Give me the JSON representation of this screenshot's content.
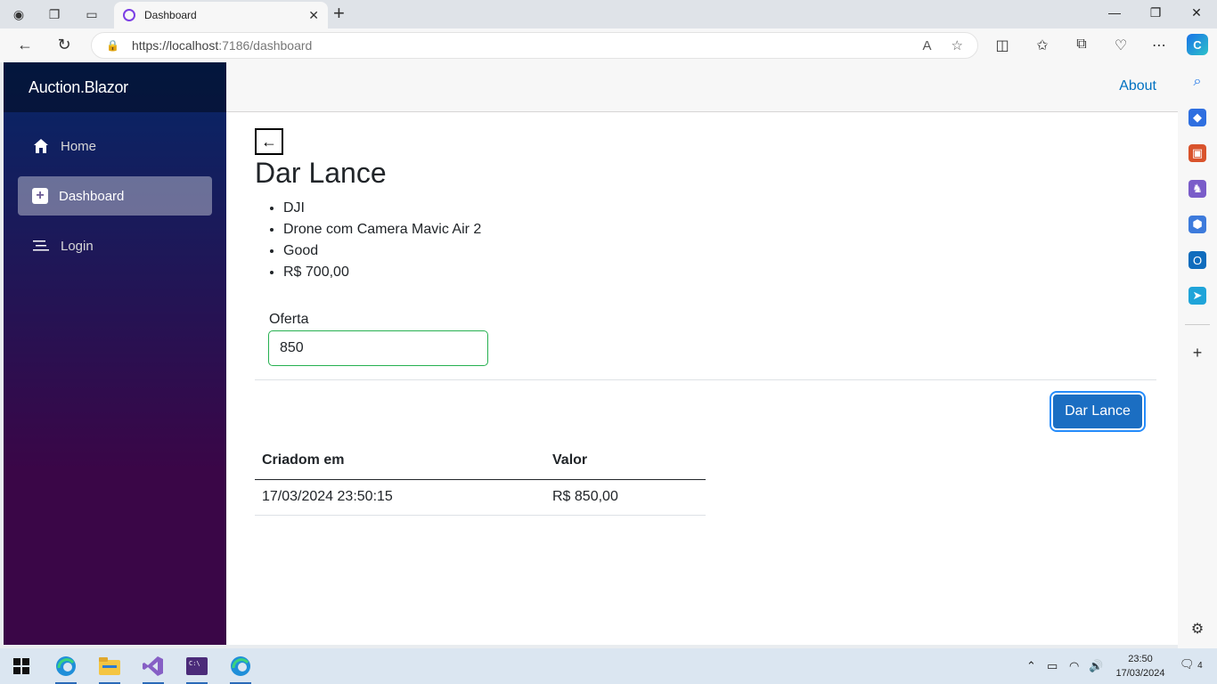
{
  "browser": {
    "tab_title": "Dashboard",
    "url_host": "https://localhost",
    "url_rest": ":7186/dashboard"
  },
  "app": {
    "brand": "Auction.Blazor",
    "about_link": "About",
    "nav": [
      {
        "label": "Home",
        "icon": "home-icon"
      },
      {
        "label": "Dashboard",
        "icon": "plus-square-icon",
        "active": true
      },
      {
        "label": "Login",
        "icon": "list-icon"
      }
    ]
  },
  "page": {
    "back_label": "←",
    "heading": "Dar Lance",
    "details": [
      "DJI",
      "Drone com Camera Mavic Air 2",
      "Good",
      "R$ 700,00"
    ],
    "offer_label": "Oferta",
    "offer_value": "850",
    "submit_label": "Dar Lance",
    "table": {
      "headers": [
        "Criadom em",
        "Valor"
      ],
      "rows": [
        [
          "17/03/2024 23:50:15",
          "R$ 850,00"
        ]
      ]
    }
  },
  "taskbar": {
    "time": "23:50",
    "date": "17/03/2024",
    "notifications": "4"
  },
  "colors": {
    "accent": "#1b6ec2",
    "link": "#0071c1",
    "sidebar_top": "#052767",
    "sidebar_bottom": "#3a0647"
  }
}
